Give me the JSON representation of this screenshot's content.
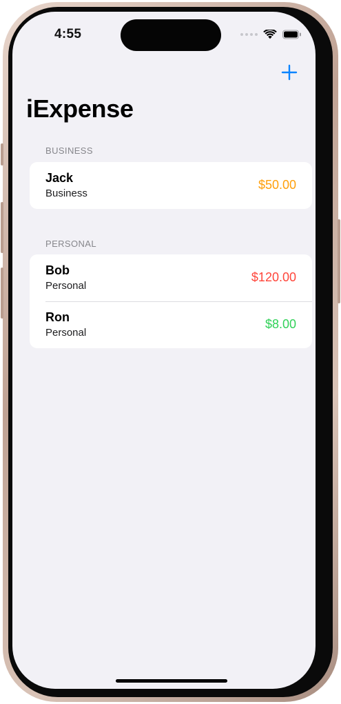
{
  "status_bar": {
    "time": "4:55",
    "signal_icon": "cellular-dots-icon",
    "wifi_icon": "wifi-icon",
    "battery_icon": "battery-icon"
  },
  "toolbar": {
    "add_icon": "plus-icon",
    "accent_color": "#0a84ff"
  },
  "nav": {
    "title": "iExpense"
  },
  "sections": [
    {
      "header": "BUSINESS",
      "items": [
        {
          "name": "Jack",
          "type": "Business",
          "amount": "$50.00",
          "amount_color": "#ff9f0a"
        }
      ]
    },
    {
      "header": "PERSONAL",
      "items": [
        {
          "name": "Bob",
          "type": "Personal",
          "amount": "$120.00",
          "amount_color": "#ff453a"
        },
        {
          "name": "Ron",
          "type": "Personal",
          "amount": "$8.00",
          "amount_color": "#30d158"
        }
      ]
    }
  ]
}
